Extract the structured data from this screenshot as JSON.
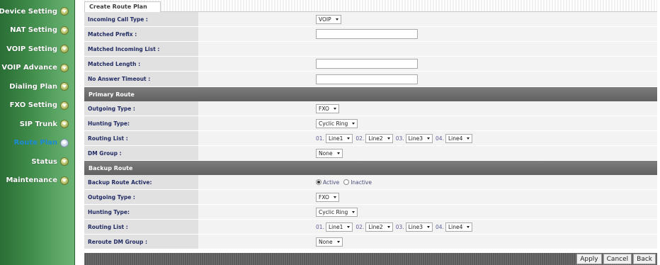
{
  "sidebar": {
    "items": [
      {
        "label": "Device Setting",
        "active": false
      },
      {
        "label": "NAT Setting",
        "active": false
      },
      {
        "label": "VOIP Setting",
        "active": false
      },
      {
        "label": "VOIP Advance",
        "active": false
      },
      {
        "label": "Dialing Plan",
        "active": false
      },
      {
        "label": "FXO Setting",
        "active": false
      },
      {
        "label": "SIP Trunk",
        "active": false
      },
      {
        "label": "Route Plan",
        "active": true
      },
      {
        "label": "Status",
        "active": false
      },
      {
        "label": "Maintenance",
        "active": false
      }
    ]
  },
  "tab": {
    "label": "Create Route Plan"
  },
  "form": {
    "incoming_call_type": {
      "label": "Incoming Call Type :",
      "value": "VOIP"
    },
    "matched_prefix": {
      "label": "Matched Prefix :",
      "value": ""
    },
    "matched_incoming_list": {
      "label": "Matched Incoming List :"
    },
    "matched_length": {
      "label": "Matched Length :",
      "value": ""
    },
    "no_answer_timeout": {
      "label": "No Answer Timeout :",
      "value": ""
    }
  },
  "primary": {
    "header": "Primary Route",
    "outgoing_type": {
      "label": "Outgoing Type :",
      "value": "FXO"
    },
    "hunting_type": {
      "label": "Hunting Type:",
      "value": "Cyclic Ring"
    },
    "routing_list": {
      "label": "Routing List :",
      "entries": [
        {
          "num": "01.",
          "value": "Line1"
        },
        {
          "num": "02.",
          "value": "Line2"
        },
        {
          "num": "03.",
          "value": "Line3"
        },
        {
          "num": "04.",
          "value": "Line4"
        }
      ]
    },
    "dm_group": {
      "label": "DM Group :",
      "value": "None"
    }
  },
  "backup": {
    "header": "Backup Route",
    "active": {
      "label": "Backup Route Active:",
      "option_active": "Active",
      "option_inactive": "Inactive",
      "selected": "Active"
    },
    "outgoing_type": {
      "label": "Outgoing Type :",
      "value": "FXO"
    },
    "hunting_type": {
      "label": "Hunting Type:",
      "value": "Cyclic Ring"
    },
    "routing_list": {
      "label": "Routing List :",
      "entries": [
        {
          "num": "01.",
          "value": "Line1"
        },
        {
          "num": "02.",
          "value": "Line2"
        },
        {
          "num": "03.",
          "value": "Line3"
        },
        {
          "num": "04.",
          "value": "Line4"
        }
      ]
    },
    "reroute_dm_group": {
      "label": "Reroute DM Group :",
      "value": "None"
    }
  },
  "buttons": {
    "apply": "Apply",
    "cancel": "Cancel",
    "back": "Back"
  },
  "colors": {
    "sidebar_green": "#3f8b49",
    "active_menu": "#1a8ad6",
    "label_text": "#222c63",
    "section_header": "#6e6e6e"
  }
}
